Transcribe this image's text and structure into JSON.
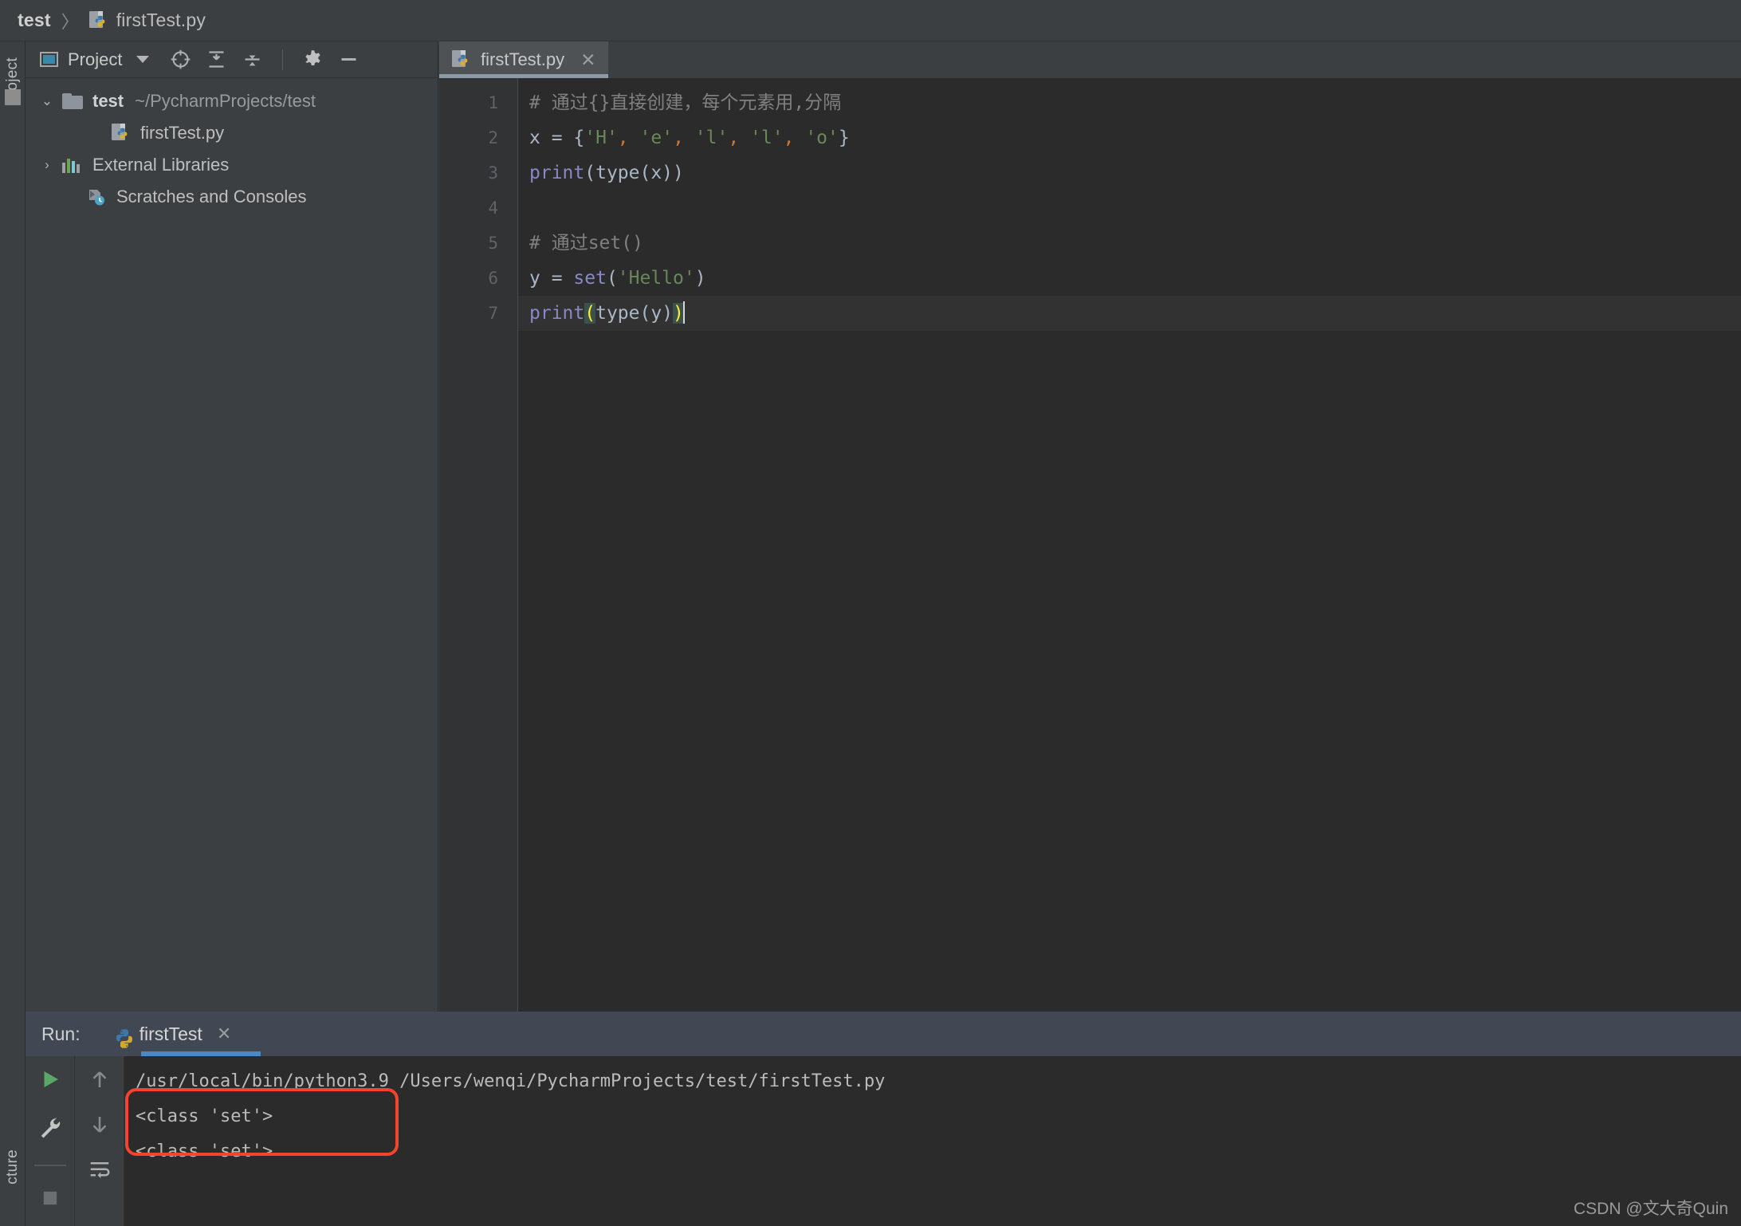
{
  "breadcrumb": {
    "project": "test",
    "separator": "〉",
    "file": "firstTest.py",
    "file_icon": "python-file-icon"
  },
  "left_strip": {
    "project_label": "Project",
    "structure_label": "cture"
  },
  "project_panel": {
    "toolbar": {
      "title": "Project",
      "dropdown_icon": "chevron-down-icon",
      "window_icon": "project-window-icon",
      "locate_icon": "crosshair-target-icon",
      "expand_all_icon": "expand-all-icon",
      "collapse_all_icon": "collapse-all-icon",
      "settings_icon": "gear-icon",
      "hide_icon": "minimize-icon"
    },
    "tree": [
      {
        "arrow": "⌄",
        "icon": "folder-icon",
        "label": "test",
        "path": "~/PycharmProjects/test",
        "level": 1,
        "expanded": true
      },
      {
        "arrow": "",
        "icon": "python-file-icon",
        "label": "firstTest.py",
        "path": "",
        "level": 2,
        "expanded": false
      },
      {
        "arrow": "›",
        "icon": "library-bars-icon",
        "label": "External Libraries",
        "path": "",
        "level": 1,
        "expanded": false
      },
      {
        "arrow": "",
        "icon": "scratches-clock-icon",
        "label": "Scratches and Consoles",
        "path": "",
        "level": 1,
        "expanded": false
      }
    ]
  },
  "editor": {
    "tab": {
      "title": "firstTest.py",
      "icon": "python-file-icon",
      "close_icon": "close-icon",
      "active": true
    },
    "line_numbers": [
      "1",
      "2",
      "3",
      "4",
      "5",
      "6",
      "7"
    ],
    "current_line": 7,
    "lines": [
      {
        "n": "1",
        "tokens": [
          {
            "t": "# 通过{}直接创建，每个元素用,分隔",
            "c": "cmt"
          }
        ]
      },
      {
        "n": "2",
        "tokens": [
          {
            "t": "x = {",
            "c": "punct"
          },
          {
            "t": "'H'",
            "c": "str"
          },
          {
            "t": ",",
            "c": "comma"
          },
          {
            "t": " ",
            "c": "punct"
          },
          {
            "t": "'e'",
            "c": "str"
          },
          {
            "t": ",",
            "c": "comma"
          },
          {
            "t": " ",
            "c": "punct"
          },
          {
            "t": "'l'",
            "c": "str"
          },
          {
            "t": ",",
            "c": "comma"
          },
          {
            "t": " ",
            "c": "punct"
          },
          {
            "t": "'l'",
            "c": "str"
          },
          {
            "t": ",",
            "c": "comma"
          },
          {
            "t": " ",
            "c": "punct"
          },
          {
            "t": "'o'",
            "c": "str"
          },
          {
            "t": "}",
            "c": "punct"
          }
        ]
      },
      {
        "n": "3",
        "tokens": [
          {
            "t": "print",
            "c": "kw-fn"
          },
          {
            "t": "(type(x))",
            "c": "punct"
          }
        ]
      },
      {
        "n": "4",
        "tokens": []
      },
      {
        "n": "5",
        "tokens": [
          {
            "t": "# 通过set()",
            "c": "cmt"
          }
        ]
      },
      {
        "n": "6",
        "tokens": [
          {
            "t": "y = ",
            "c": "punct"
          },
          {
            "t": "set",
            "c": "kw-fn"
          },
          {
            "t": "(",
            "c": "punct"
          },
          {
            "t": "'Hello'",
            "c": "str"
          },
          {
            "t": ")",
            "c": "punct"
          }
        ]
      },
      {
        "n": "7",
        "tokens": [
          {
            "t": "print",
            "c": "kw-fn"
          },
          {
            "t": "(",
            "c": "match-paren"
          },
          {
            "t": "type(y)",
            "c": "punct"
          },
          {
            "t": ")",
            "c": "match-paren"
          }
        ]
      }
    ]
  },
  "run_panel": {
    "label": "Run:",
    "tab_name": "firstTest",
    "tab_icon": "python-icon",
    "close_icon": "close-icon",
    "toolbar": {
      "run_icon": "run-play-icon",
      "wrench_icon": "wrench-icon",
      "stop_icon": "stop-square-icon",
      "up_icon": "arrow-up-icon",
      "down_icon": "arrow-down-icon",
      "soft_wrap_icon": "soft-wrap-icon"
    },
    "console": [
      "/usr/local/bin/python3.9 /Users/wenqi/PycharmProjects/test/firstTest.py",
      "<class 'set'>",
      "<class 'set'>"
    ],
    "annotation_color": "#f4442e"
  },
  "watermark": "CSDN @文大奇Quin",
  "colors": {
    "window_bg": "#3c3f41",
    "editor_bg": "#2b2b2b",
    "gutter_bg": "#313335",
    "tab_active_bg": "#4e5254",
    "tab_underline": "#8d9aa8",
    "run_header_bg": "#414854",
    "run_tab_underline": "#4a88c7",
    "comment": "#808080",
    "string": "#6a8759",
    "function": "#8888c6",
    "comma": "#cc7832",
    "match_paren": "#ffef28",
    "annotation": "#f4442e"
  }
}
